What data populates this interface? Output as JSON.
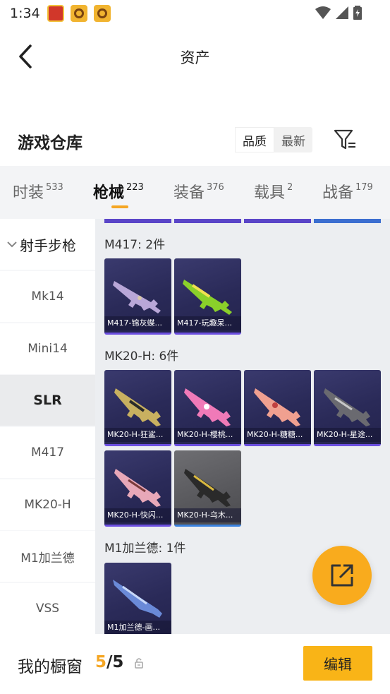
{
  "status_bar": {
    "time": "1:34",
    "app_icons": [
      "game-app-icon",
      "orange-app-icon",
      "orange-app-icon"
    ]
  },
  "header": {
    "title": "资产"
  },
  "warehouse": {
    "title": "游戏仓库",
    "sort_options": [
      "品质",
      "最新"
    ],
    "active_sort": "品质"
  },
  "tabs": [
    {
      "label": "时装",
      "count": "533"
    },
    {
      "label": "枪械",
      "count": "223"
    },
    {
      "label": "装备",
      "count": "376"
    },
    {
      "label": "载具",
      "count": "2"
    },
    {
      "label": "战备",
      "count": "179"
    }
  ],
  "active_tab": "枪械",
  "sidebar": {
    "group": "射手步枪",
    "items": [
      "Mk14",
      "Mini14",
      "SLR",
      "M417",
      "MK20-H",
      "M1加兰德",
      "VSS"
    ],
    "selected": "SLR"
  },
  "sections": [
    {
      "title": "M417: 2件",
      "items": [
        "M417-锦灰蝶...",
        "M417-玩趣呆..."
      ]
    },
    {
      "title": "MK20-H: 6件",
      "items": [
        "MK20-H-狂鲨...",
        "MK20-H-樱桃...",
        "MK20-H-糖糖...",
        "MK20-H-星途...",
        "MK20-H-快闪...",
        "MK20-H-乌木..."
      ]
    },
    {
      "title": "M1加兰德: 1件",
      "items": [
        "M1加兰德-画..."
      ]
    }
  ],
  "bottom_bar": {
    "label": "我的橱窗",
    "current": "5",
    "separator": "/",
    "total": "5",
    "edit_label": "编辑"
  },
  "colors": {
    "accent": "#f9b417",
    "card_bg": "#2f2f60",
    "card_border_purple": "#6c4fe0",
    "card_border_blue": "#3b82e0"
  }
}
